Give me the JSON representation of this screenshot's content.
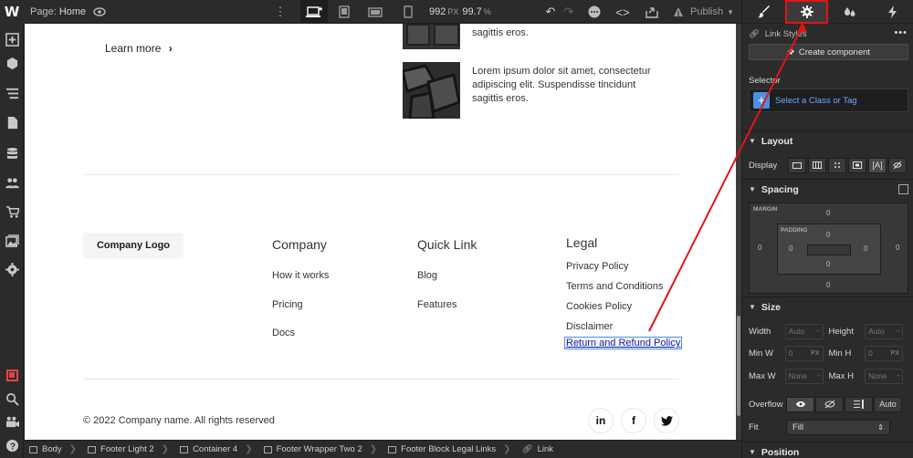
{
  "topbar": {
    "logo": "W",
    "page_prefix": "Page:",
    "page_name": "Home",
    "width_value": "992",
    "width_unit": "PX",
    "zoom_value": "99.7",
    "zoom_unit": "%",
    "publish_label": "Publish"
  },
  "canvas": {
    "learn_more": "Learn more",
    "learn_more_chevron": "›",
    "articles": [
      {
        "text": "sagittis eros."
      },
      {
        "text": "Lorem ipsum dolor sit amet, consectetur adipiscing elit. Suspendisse tincidunt sagittis eros."
      }
    ],
    "company_logo": "Company Logo",
    "columns": [
      {
        "title": "Company",
        "links": [
          "How it works",
          "Pricing",
          "Docs"
        ]
      },
      {
        "title": "Quick Link",
        "links": [
          "Blog",
          "Features"
        ]
      },
      {
        "title": "Legal",
        "links": [
          "Privacy Policy",
          "Terms and Conditions",
          "Cookies Policy",
          "Disclaimer",
          "Return and Refund Policy"
        ]
      }
    ],
    "copyright": "© 2022 Company name. All rights reserved",
    "social": [
      "in",
      "f",
      "𝕏"
    ]
  },
  "breadcrumbs": [
    "Body",
    "Footer Light 2",
    "Container 4",
    "Footer Wrapper Two 2",
    "Footer Block Legal Links",
    "Link"
  ],
  "panel": {
    "tabs": [
      "style",
      "settings",
      "interactions",
      "lightning"
    ],
    "active_tab": "settings",
    "link_styles": "Link Styles",
    "create_component": "Create component",
    "selector_label": "Selector",
    "selector_placeholder": "Select a Class or Tag",
    "layout": {
      "title": "Layout",
      "display_label": "Display"
    },
    "spacing": {
      "title": "Spacing",
      "margin_label": "MARGIN",
      "padding_label": "PADDING",
      "margin": {
        "top": "0",
        "right": "0",
        "bottom": "0",
        "left": "0"
      },
      "padding": {
        "top": "0",
        "right": "0",
        "bottom": "0",
        "left": "0"
      }
    },
    "size": {
      "title": "Size",
      "width_label": "Width",
      "width_value": "Auto",
      "height_label": "Height",
      "height_value": "Auto",
      "minw_label": "Min W",
      "minw_value": "0",
      "minw_unit": "PX",
      "minh_label": "Min H",
      "minh_value": "0",
      "minh_unit": "PX",
      "maxw_label": "Max W",
      "maxw_value": "None",
      "maxh_label": "Max H",
      "maxh_value": "None",
      "overflow_label": "Overflow",
      "overflow_auto": "Auto",
      "fit_label": "Fit",
      "fit_value": "Fill"
    },
    "position": {
      "title": "Position"
    }
  },
  "colors": {
    "accent": "#4a90e2",
    "annotation": "#e31414",
    "panel_bg": "#2b2b2b"
  }
}
